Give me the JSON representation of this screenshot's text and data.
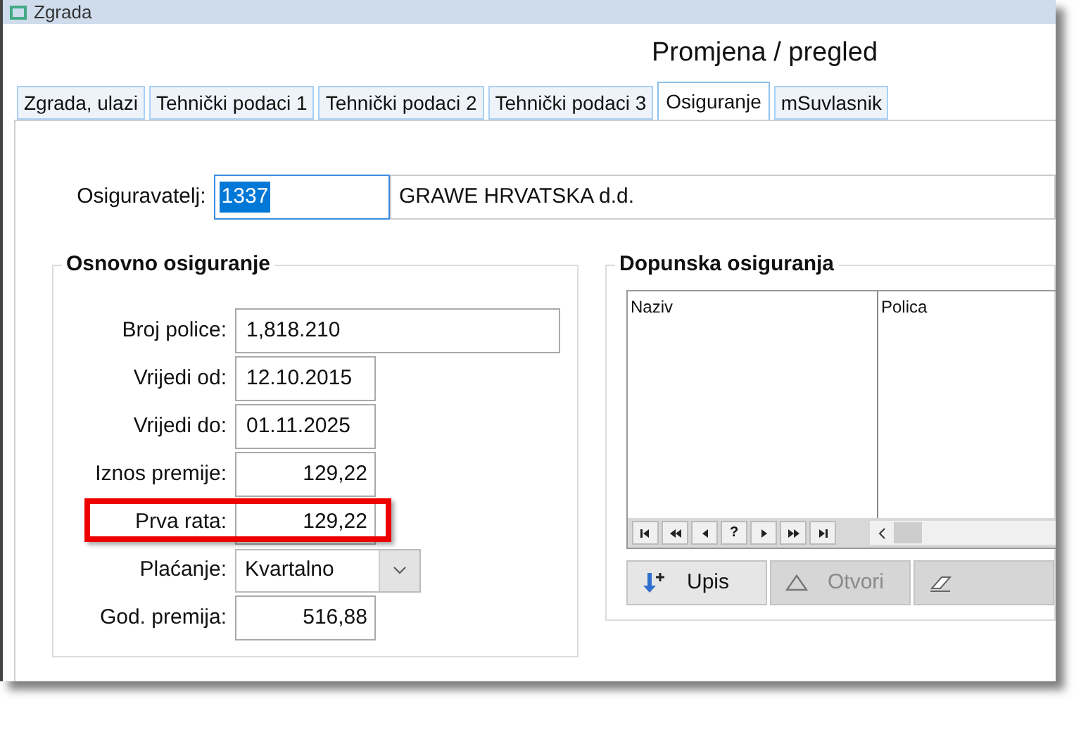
{
  "window": {
    "title": "Zgrada"
  },
  "heading": "Promjena / pregled",
  "tabs": [
    {
      "label": "Zgrada, ulazi",
      "selected": false
    },
    {
      "label": "Tehnički podaci 1",
      "selected": false
    },
    {
      "label": "Tehnički podaci 2",
      "selected": false
    },
    {
      "label": "Tehnički podaci 3",
      "selected": false
    },
    {
      "label": "Osiguranje",
      "selected": true
    },
    {
      "label": "mSuvlasnik",
      "selected": false
    }
  ],
  "insurer": {
    "label": "Osiguravatelj:",
    "code": "1337",
    "code_selected": true,
    "name": "GRAWE HRVATSKA d.d."
  },
  "basic_insurance": {
    "title": "Osnovno osiguranje",
    "fields": [
      {
        "label": "Broj police:",
        "value": "1,818.210",
        "kind": "wide",
        "highlighted": false
      },
      {
        "label": "Vrijedi od:",
        "value": "12.10.2015",
        "kind": "text",
        "highlighted": false
      },
      {
        "label": "Vrijedi do:",
        "value": "01.11.2025",
        "kind": "text",
        "highlighted": false
      },
      {
        "label": "Iznos premije:",
        "value": "129,22",
        "kind": "number",
        "highlighted": false
      },
      {
        "label": "Prva rata:",
        "value": "129,22",
        "kind": "number",
        "highlighted": true
      },
      {
        "label": "Plaćanje:",
        "value": "Kvartalno",
        "kind": "combo",
        "highlighted": false
      },
      {
        "label": "God. premija:",
        "value": "516,88",
        "kind": "number",
        "highlighted": false
      }
    ]
  },
  "supplementary_insurance": {
    "title": "Dopunska osiguranja",
    "table": {
      "columns": [
        "Naziv",
        "Polica"
      ]
    },
    "navigator": [
      {
        "kind": "first"
      },
      {
        "kind": "prev_page"
      },
      {
        "kind": "prev"
      },
      {
        "kind": "text",
        "label": "?"
      },
      {
        "kind": "next"
      },
      {
        "kind": "next_page"
      },
      {
        "kind": "last"
      }
    ],
    "buttons": [
      {
        "label": "Upis",
        "kind": "add",
        "disabled": false
      },
      {
        "label": "Otvori",
        "kind": "open",
        "disabled": true
      },
      {
        "kind": "erase",
        "disabled": true
      }
    ]
  }
}
